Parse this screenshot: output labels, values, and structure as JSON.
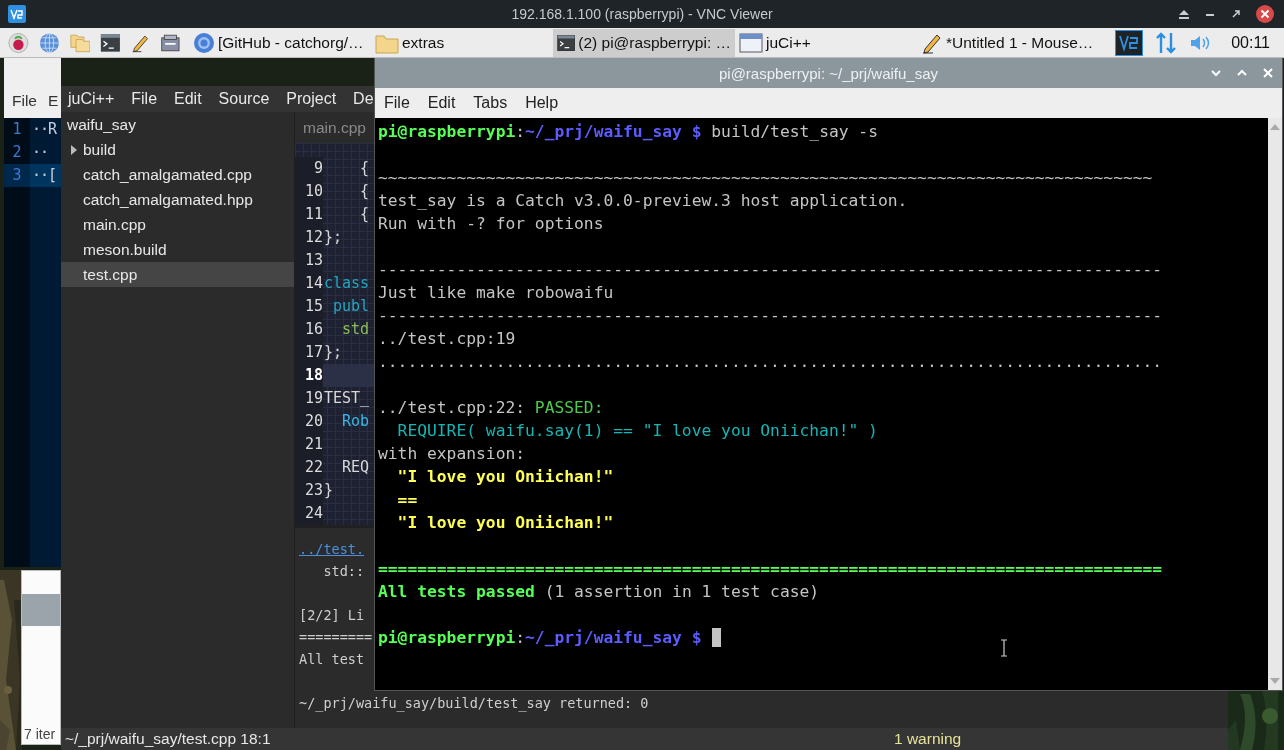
{
  "vnc_window": {
    "title": "192.168.1.100 (raspberrypi) - VNC Viewer"
  },
  "taskbar": {
    "tasks": [
      {
        "kind": "browser",
        "label": "[GitHub - catchorg/…",
        "selected": false
      },
      {
        "kind": "folder",
        "label": "extras",
        "selected": false
      },
      {
        "kind": "terminal",
        "label": "(2) pi@raspberrypi: …",
        "selected": true
      },
      {
        "kind": "window",
        "label": "juCi++",
        "selected": false
      },
      {
        "kind": "editor",
        "label": "*Untitled 1 - Mouse…",
        "selected": false
      }
    ],
    "clock": "00:11"
  },
  "mousepad_window": {
    "menu": [
      "File",
      "E"
    ],
    "lines": [
      {
        "number": "1",
        "text": "··R",
        "selected": false
      },
      {
        "number": "2",
        "text": "··",
        "selected": false
      },
      {
        "number": "3",
        "text": "··[",
        "selected": true
      }
    ]
  },
  "file_manager": {
    "status": "7 iter"
  },
  "juci_window": {
    "menu": [
      "juCi++",
      "File",
      "Edit",
      "Source",
      "Project",
      "De"
    ],
    "tree": [
      {
        "label": "waifu_say",
        "selected": false,
        "children": [
          {
            "label": "build",
            "kind": "folder",
            "expanded": false,
            "selected": false
          },
          {
            "label": "catch_amalgamated.cpp",
            "kind": "file",
            "selected": false
          },
          {
            "label": "catch_amalgamated.hpp",
            "kind": "file",
            "selected": false
          },
          {
            "label": "main.cpp",
            "kind": "file",
            "selected": false
          },
          {
            "label": "meson.build",
            "kind": "file",
            "selected": false
          },
          {
            "label": "test.cpp",
            "kind": "file",
            "selected": true
          }
        ]
      }
    ],
    "tabs": [
      {
        "label": "main.cpp",
        "selected": false
      }
    ],
    "code_lines": [
      {
        "number": "9",
        "text": "    {",
        "kind": "plain",
        "current": false
      },
      {
        "number": "10",
        "text": "    {",
        "kind": "plain",
        "current": false
      },
      {
        "number": "11",
        "text": "    {",
        "kind": "plain",
        "current": false
      },
      {
        "number": "12",
        "text": "};",
        "kind": "plain",
        "current": false
      },
      {
        "number": "13",
        "current": false
      },
      {
        "number": "14",
        "text": "class",
        "kind": "keyword",
        "current": false
      },
      {
        "number": "15",
        "text": " publ",
        "kind": "keyword",
        "current": false
      },
      {
        "number": "16",
        "text": "  std",
        "kind": "type",
        "current": false
      },
      {
        "number": "17",
        "text": "};",
        "kind": "plain",
        "current": false
      },
      {
        "number": "18",
        "current": true
      },
      {
        "number": "19",
        "text": "TEST_",
        "kind": "plain",
        "current": false
      },
      {
        "number": "20",
        "text": "  Rob",
        "kind": "name",
        "current": false
      },
      {
        "number": "21",
        "current": false
      },
      {
        "number": "22",
        "text": "  REQ",
        "kind": "plain",
        "current": false
      },
      {
        "number": "23",
        "text": "}",
        "kind": "plain",
        "current": false
      },
      {
        "number": "24",
        "current": false
      }
    ],
    "output": [
      {
        "kind": "link",
        "text": "../test."
      },
      {
        "kind": "plain",
        "text": "   std::"
      },
      {
        "kind": "blank"
      },
      {
        "kind": "plain",
        "text": "[2/2] Li"
      },
      {
        "kind": "plain",
        "text": "========="
      },
      {
        "kind": "plain",
        "text": "All test"
      },
      {
        "kind": "blank"
      },
      {
        "kind": "plain",
        "text": "~/_prj/waifu_say/build/test_say returned: 0"
      }
    ],
    "status_bar": {
      "position": "~/_prj/waifu_say/test.cpp 18:1",
      "warnings": "1 warning"
    }
  },
  "terminal": {
    "title": "pi@raspberrypi: ~/_prj/waifu_say",
    "menu": [
      "File",
      "Edit",
      "Tabs",
      "Help"
    ],
    "lines": [
      {
        "kind": "text",
        "segments": [
          {
            "kind": "user",
            "text": "pi@raspberrypi"
          },
          {
            "kind": "plain",
            "text": ":"
          },
          {
            "kind": "path",
            "text": "~/_prj/waifu_say $"
          },
          {
            "kind": "plain",
            "text": " build/test_say -s"
          }
        ]
      },
      {
        "kind": "blank"
      },
      {
        "kind": "text",
        "segments": [
          {
            "kind": "plain",
            "text": "~~~~~~~~~~~~~~~~~~~~~~~~~~~~~~~~~~~~~~~~~~~~~~~~~~~~~~~~~~~~~~~~~~~~~~~~~~~~~~~"
          }
        ]
      },
      {
        "kind": "text",
        "segments": [
          {
            "kind": "plain",
            "text": "test_say is a Catch v3.0.0-preview.3 host application."
          }
        ]
      },
      {
        "kind": "text",
        "segments": [
          {
            "kind": "plain",
            "text": "Run with -? for options"
          }
        ]
      },
      {
        "kind": "blank"
      },
      {
        "kind": "text",
        "segments": [
          {
            "kind": "plain",
            "text": "--------------------------------------------------------------------------------"
          }
        ]
      },
      {
        "kind": "text",
        "segments": [
          {
            "kind": "plain",
            "text": "Just like make robowaifu"
          }
        ]
      },
      {
        "kind": "text",
        "segments": [
          {
            "kind": "plain",
            "text": "--------------------------------------------------------------------------------"
          }
        ]
      },
      {
        "kind": "text",
        "segments": [
          {
            "kind": "plain",
            "text": "../test.cpp:19"
          }
        ]
      },
      {
        "kind": "text",
        "segments": [
          {
            "kind": "plain",
            "text": "................................................................................"
          }
        ]
      },
      {
        "kind": "blank"
      },
      {
        "kind": "text",
        "segments": [
          {
            "kind": "plain",
            "text": "../test.cpp:22: "
          },
          {
            "kind": "pass",
            "text": "PASSED:"
          }
        ]
      },
      {
        "kind": "text",
        "segments": [
          {
            "kind": "expr",
            "text": "  REQUIRE( waifu.say(1) == \"I love you Oniichan!\" )"
          }
        ]
      },
      {
        "kind": "text",
        "segments": [
          {
            "kind": "plain",
            "text": "with expansion:"
          }
        ]
      },
      {
        "kind": "text",
        "segments": [
          {
            "kind": "value",
            "text": "  \"I love you Oniichan!\""
          }
        ]
      },
      {
        "kind": "text",
        "segments": [
          {
            "kind": "value",
            "text": "  =="
          }
        ]
      },
      {
        "kind": "text",
        "segments": [
          {
            "kind": "value",
            "text": "  \"I love you Oniichan!\""
          }
        ]
      },
      {
        "kind": "blank"
      },
      {
        "kind": "text",
        "segments": [
          {
            "kind": "ok",
            "text": "================================================================================"
          }
        ]
      },
      {
        "kind": "text",
        "segments": [
          {
            "kind": "ok",
            "text": "All tests passed"
          },
          {
            "kind": "plain",
            "text": " (1 assertion in 1 test case)"
          }
        ]
      },
      {
        "kind": "blank"
      },
      {
        "kind": "text",
        "cursor": true,
        "segments": [
          {
            "kind": "user",
            "text": "pi@raspberrypi"
          },
          {
            "kind": "plain",
            "text": ":"
          },
          {
            "kind": "path",
            "text": "~/_prj/waifu_say $"
          }
        ]
      }
    ]
  }
}
